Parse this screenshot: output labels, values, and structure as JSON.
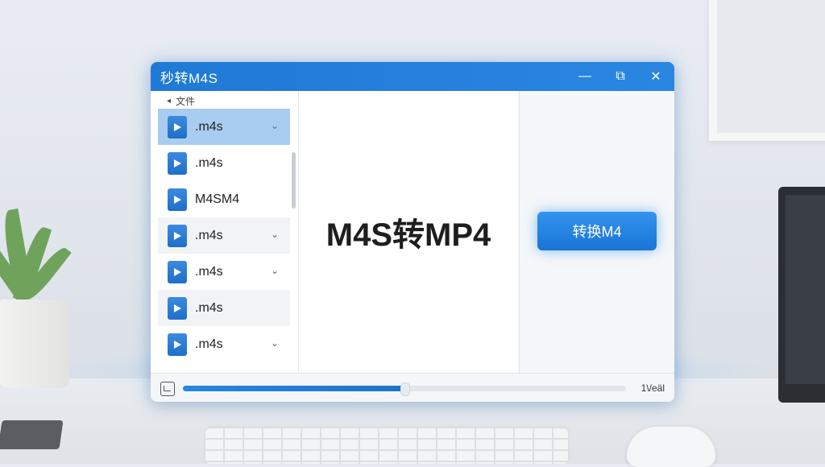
{
  "window": {
    "title": "秒转M4S",
    "minimize_glyph": "—",
    "restore_glyph": "⧉",
    "close_glyph": "✕"
  },
  "sidebar": {
    "header_arrow": "◂",
    "header_label": "文件",
    "items": [
      {
        "label": ".m4s",
        "selected": true,
        "chevron": "⌄"
      },
      {
        "label": ".m4s",
        "chevron": ""
      },
      {
        "label": "M4SM4",
        "chevron": ""
      },
      {
        "label": ".m4s",
        "chevron": "⌄"
      },
      {
        "label": ".m4s",
        "chevron": "⌄"
      },
      {
        "label": ".m4s",
        "chevron": ""
      },
      {
        "label": ".m4s",
        "chevron": "⌄"
      }
    ]
  },
  "main": {
    "heading": "M4S转MP4"
  },
  "action": {
    "convert_label": "转换M4"
  },
  "status": {
    "progress": 0.5,
    "text": "1\\/еäl"
  },
  "colors": {
    "titlebar": "#1f7ad6",
    "accent": "#2a86e0",
    "selected_row": "#a9cdf1"
  }
}
